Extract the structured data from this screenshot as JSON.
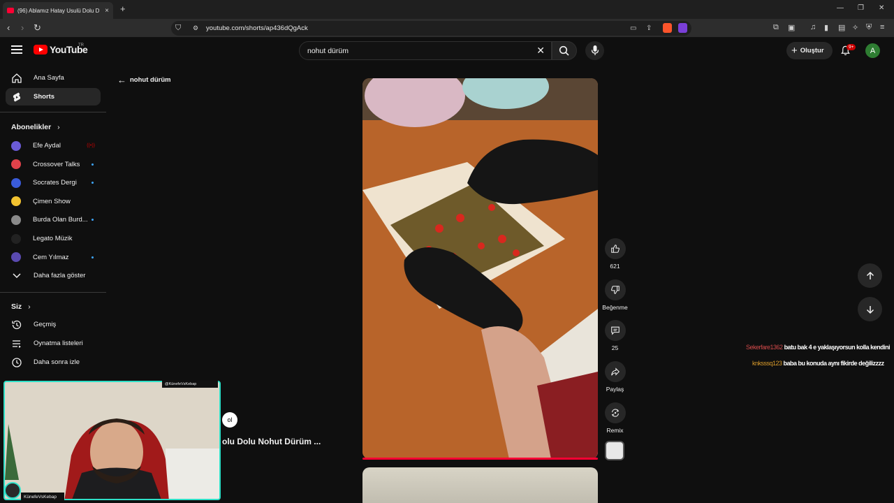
{
  "browser": {
    "tab_title": "(96) Ablamız Hatay Usulü Dolu D",
    "url": "youtube.com/shorts/ap436dQgAck",
    "new_tab": "+",
    "close_tab": "×"
  },
  "header": {
    "logo_text": "YouTube",
    "region": "TR",
    "search_query": "nohut dürüm",
    "create_label": "Oluştur",
    "notifications_badge": "9+",
    "avatar_letter": "A"
  },
  "sidebar": {
    "home": "Ana Sayfa",
    "shorts": "Shorts",
    "subscriptions_title": "Abonelikler",
    "subscriptions": [
      {
        "name": "Efe Aydal",
        "color": "#6b5bd6",
        "indicator": "live"
      },
      {
        "name": "Crossover Talks",
        "color": "#e0424a",
        "indicator": "dot"
      },
      {
        "name": "Socrates Dergi",
        "color": "#3a5bd9",
        "indicator": "dot"
      },
      {
        "name": "Çimen Show",
        "color": "#f2c230",
        "indicator": "none"
      },
      {
        "name": "Burda Olan Burd...",
        "color": "#8a8a8a",
        "indicator": "dot"
      },
      {
        "name": "Legato Müzik",
        "color": "#222222",
        "indicator": "none"
      },
      {
        "name": "Cem Yılmaz",
        "color": "#5a4ab0",
        "indicator": "dot"
      }
    ],
    "show_more": "Daha fazla göster",
    "you_title": "Siz",
    "history": "Geçmiş",
    "playlists": "Oynatma listeleri",
    "watch_later": "Daha sonra izle"
  },
  "page": {
    "back_label": "nohut dürüm",
    "video_title_partial": "olu Dolu Nohut Dürüm ...",
    "pill_text": "ol"
  },
  "actions": {
    "likes": "621",
    "dislike": "Beğenme",
    "comments": "25",
    "share": "Paylaş",
    "remix": "Remix"
  },
  "chat": [
    {
      "user": "Sekerfare1362",
      "message": "batu bak 4 e yaklaşıyorsun kolla kendini"
    },
    {
      "user": "knksssq123",
      "message": "baba bu konuda aynı fikirde değilizzzz"
    }
  ],
  "webcam": {
    "handle": "@KünefeVsKebap",
    "name": "KünefeVsKebap"
  },
  "colors": {
    "accent": "#ff0033",
    "background": "#0f0f0f",
    "cam_border": "#2ee0c8"
  }
}
